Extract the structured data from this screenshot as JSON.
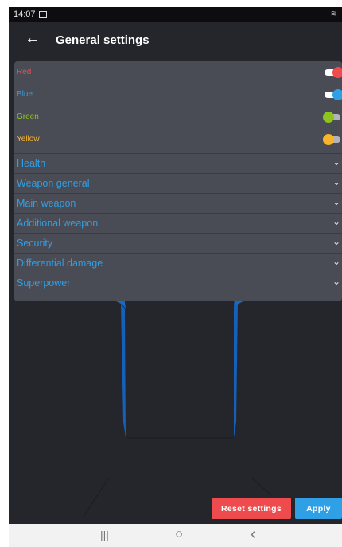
{
  "status_bar": {
    "time": "14:07"
  },
  "app_bar": {
    "title": "General settings"
  },
  "colors": [
    {
      "label": "Red",
      "color": "#ee4b4e",
      "enabled": true
    },
    {
      "label": "Blue",
      "color": "#2f9fe6",
      "enabled": true
    },
    {
      "label": "Green",
      "color": "#8fc31f",
      "enabled": false
    },
    {
      "label": "Yellow",
      "color": "#f7b52c",
      "enabled": false
    }
  ],
  "sections": [
    "Health",
    "Weapon general",
    "Main weapon",
    "Additional weapon",
    "Security",
    "Differential damage",
    "Superpower"
  ],
  "buttons": {
    "reset": "Reset settings",
    "apply": "Apply"
  },
  "nav_bar": {
    "recents": "|||",
    "home": "○",
    "back": "‹"
  },
  "theme": {
    "background": "#25262b",
    "panel": "#4a4c55",
    "accent": "#2f9fe6"
  }
}
